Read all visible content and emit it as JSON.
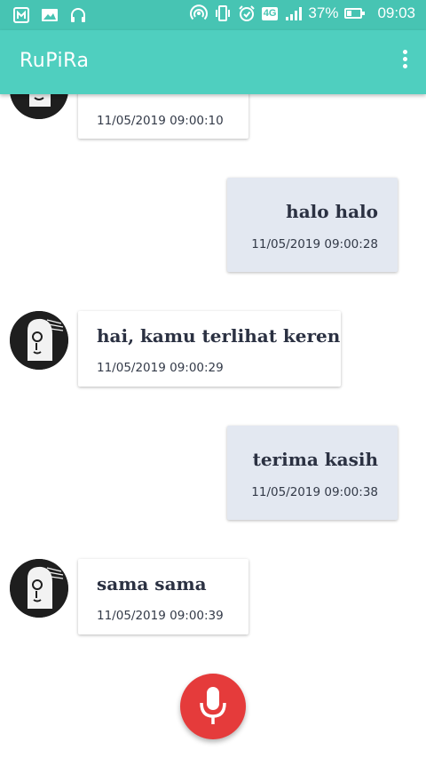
{
  "status_bar": {
    "network_type": "4G",
    "battery_percent": "37%",
    "battery_level": 0.37,
    "time": "09:03",
    "icons": [
      "nfc-icon",
      "image-icon",
      "headset-icon",
      "hotspot-icon",
      "vibrate-icon",
      "alarm-icon",
      "signal-icon",
      "battery-icon"
    ]
  },
  "app_bar": {
    "title": "RuPiRa",
    "menu_icon": "more-vert-icon"
  },
  "colors": {
    "status_bar": "#47c4b3",
    "app_bar": "#4fcfbf",
    "user_bubble": "#e3e8f1",
    "bot_bubble": "#ffffff",
    "mic_button": "#e53b3b"
  },
  "messages": [
    {
      "sender": "bot",
      "text": "",
      "time": "11/05/2019 09:00:10"
    },
    {
      "sender": "user",
      "text": "halo halo",
      "time": "11/05/2019 09:00:28"
    },
    {
      "sender": "bot",
      "text": "hai, kamu terlihat keren",
      "time": "11/05/2019 09:00:29"
    },
    {
      "sender": "user",
      "text": "terima kasih",
      "time": "11/05/2019 09:00:38"
    },
    {
      "sender": "bot",
      "text": "sama sama",
      "time": "11/05/2019 09:00:39"
    }
  ],
  "fab": {
    "icon": "microphone-icon"
  }
}
